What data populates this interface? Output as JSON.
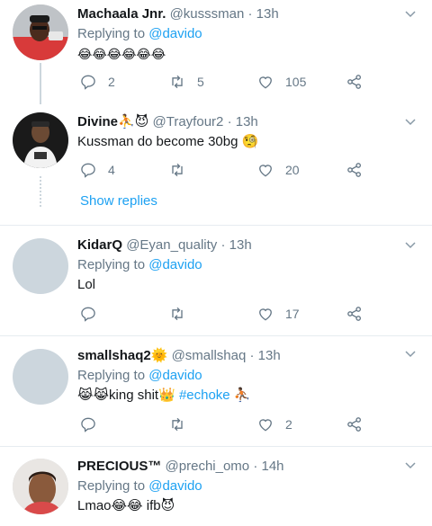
{
  "replying_to_label": "Replying to",
  "show_replies_label": "Show replies",
  "colors": {
    "link": "#1da1f2",
    "muted": "#657786",
    "divider": "#e6ecf0",
    "avatar_placeholder": "#ccd6dd"
  },
  "icons": {
    "reply": "reply-icon",
    "retweet": "retweet-icon",
    "like": "heart-icon",
    "share": "share-icon",
    "more": "chevron-down-icon"
  },
  "tweets": [
    {
      "name": "Machaala Jnr.",
      "handle": "@kusssman",
      "time": "13h",
      "reply_to": "@davido",
      "text": "😂😂😂😂😂😂",
      "replies": "2",
      "retweets": "5",
      "likes": "105"
    },
    {
      "name": "Divine⛹️😈",
      "handle": "@Trayfour2",
      "time": "13h",
      "text": "Kussman do become 30bg 🧐",
      "replies": "4",
      "retweets": "",
      "likes": "20"
    },
    {
      "name": "KidarQ",
      "handle": "@Eyan_quality",
      "time": "13h",
      "reply_to": "@davido",
      "text": "Lol",
      "replies": "",
      "retweets": "",
      "likes": "17"
    },
    {
      "name": "smallshaq2🌞",
      "handle": "@smallshaq",
      "time": "13h",
      "reply_to": "@davido",
      "text_prefix": "😹😹king shit👑",
      "hashtag": "#echoke",
      "text_suffix": "⛹🏾",
      "replies": "",
      "retweets": "",
      "likes": "2"
    },
    {
      "name": "PRECIOUS™",
      "handle": "@prechi_omo",
      "time": "14h",
      "reply_to": "@davido",
      "text": "Lmao😂😂 ifb😈"
    }
  ]
}
